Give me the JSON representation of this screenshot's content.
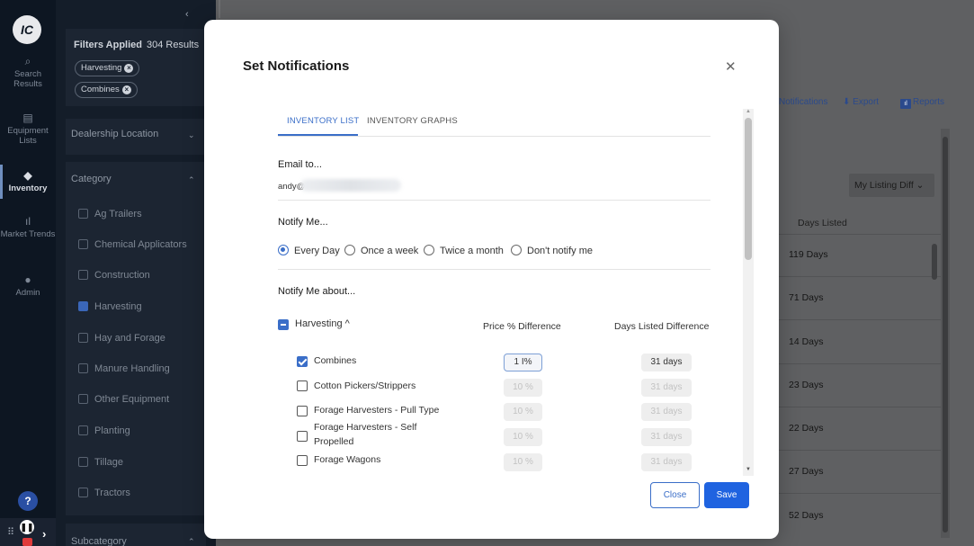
{
  "app": {
    "logo_text": "IC"
  },
  "rail": {
    "items": [
      {
        "label": "Search Results",
        "icon": "search-icon",
        "glyph": "⌕"
      },
      {
        "label": "Equipment Lists",
        "icon": "document-icon",
        "glyph": "▤"
      },
      {
        "label": "Inventory",
        "icon": "tag-icon",
        "glyph": "◆"
      },
      {
        "label": "Market Trends",
        "icon": "bar-chart-icon",
        "glyph": "ıl"
      },
      {
        "label": "Admin",
        "icon": "user-icon",
        "glyph": "●"
      }
    ],
    "help_glyph": "?"
  },
  "filters": {
    "header_label": "Filters Applied",
    "results": "304 Results",
    "chips": [
      "Harvesting",
      "Combines"
    ],
    "dealership_location": "Dealership Location",
    "category": "Category",
    "category_items": [
      {
        "label": "Ag Trailers",
        "checked": false
      },
      {
        "label": "Chemical Applicators",
        "checked": false
      },
      {
        "label": "Construction",
        "checked": false
      },
      {
        "label": "Harvesting",
        "checked": true
      },
      {
        "label": "Hay and Forage",
        "checked": false
      },
      {
        "label": "Manure Handling",
        "checked": false
      },
      {
        "label": "Other Equipment",
        "checked": false
      },
      {
        "label": "Planting",
        "checked": false
      },
      {
        "label": "Tillage",
        "checked": false
      },
      {
        "label": "Tractors",
        "checked": false
      }
    ],
    "subcategory": "Subcategory"
  },
  "page": {
    "toolbar": {
      "notifications": "Notifications",
      "export": "Export",
      "reports": "Reports"
    },
    "listing_diff_dropdown": "My Listing Diff",
    "days_listed_header": "Days Listed",
    "days_rows": [
      "119 Days",
      "71 Days",
      "14 Days",
      "23 Days",
      "22 Days",
      "27 Days",
      "52 Days"
    ]
  },
  "modal": {
    "title": "Set Notifications",
    "tabs": [
      "INVENTORY LIST",
      "INVENTORY GRAPHS"
    ],
    "active_tab": "INVENTORY LIST",
    "email_label": "Email to...",
    "email_value": "andy@",
    "notify_me_label": "Notify Me...",
    "frequency_options": [
      "Every Day",
      "Once a week",
      "Twice a month",
      "Don't notify me"
    ],
    "frequency_selected": "Every Day",
    "notify_about_label": "Notify Me about...",
    "group": {
      "label": "Harvesting",
      "expanded_glyph": "^"
    },
    "col_price": "Price % Difference",
    "col_days": "Days Listed Difference",
    "items": [
      {
        "label": "Combines",
        "checked": true,
        "price": "1",
        "price_unit": "%",
        "days": "31 days"
      },
      {
        "label": "Cotton Pickers/Strippers",
        "checked": false,
        "price": "10 %",
        "days": "31 days"
      },
      {
        "label": "Forage Harvesters - Pull Type",
        "checked": false,
        "price": "10 %",
        "days": "31 days"
      },
      {
        "label": "Forage Harvesters - Self Propelled",
        "checked": false,
        "price": "10 %",
        "days": "31 days"
      },
      {
        "label": "Forage Wagons",
        "checked": false,
        "price": "10 %",
        "days": "31 days"
      }
    ],
    "close_label": "Close",
    "save_label": "Save"
  },
  "colors": {
    "accent": "#3a6ec8",
    "save_button": "#1f63e0",
    "rail_bg": "#0d1622"
  }
}
